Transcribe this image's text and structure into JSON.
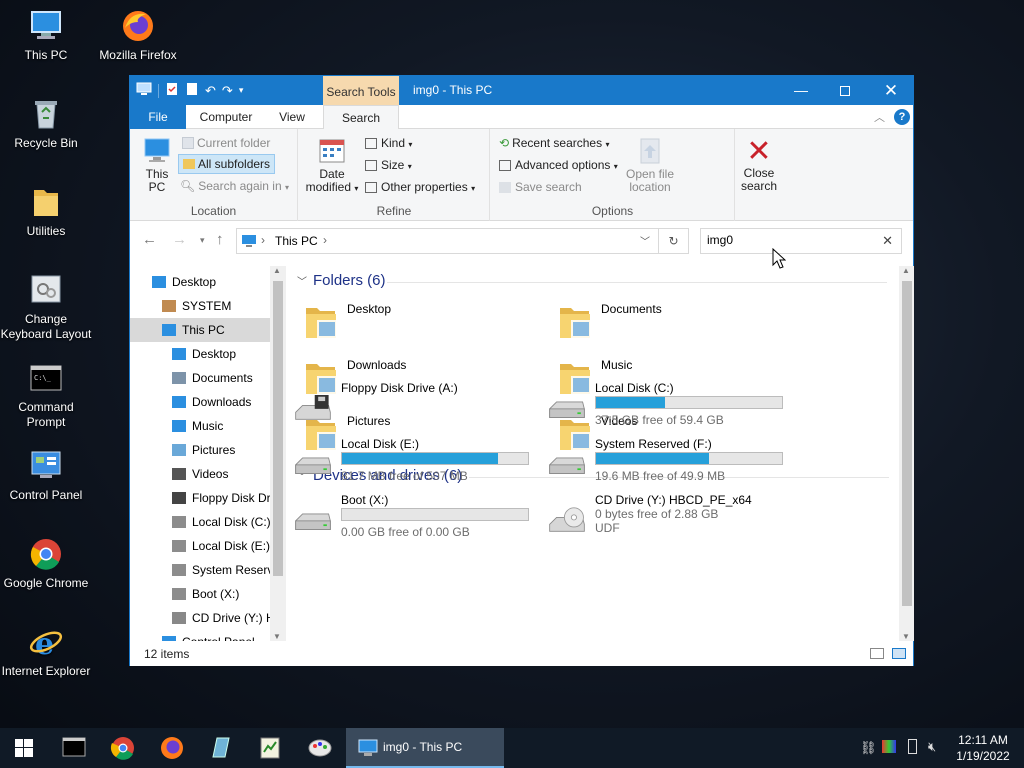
{
  "desktop": {
    "icons": [
      {
        "label": "This PC"
      },
      {
        "label": "Mozilla Firefox"
      },
      {
        "label": "Recycle Bin"
      },
      {
        "label": "Utilities"
      },
      {
        "label": "Change Keyboard Layout"
      },
      {
        "label": "Command Prompt"
      },
      {
        "label": "Control Panel"
      },
      {
        "label": "Google Chrome"
      },
      {
        "label": "Internet Explorer"
      }
    ]
  },
  "window": {
    "title": "img0 - This PC",
    "context_tab": "Search Tools",
    "tabs": {
      "file": "File",
      "computer": "Computer",
      "view": "View",
      "search": "Search"
    },
    "ribbon": {
      "location": {
        "label": "Location",
        "this_pc": "This PC",
        "current_folder": "Current folder",
        "all_subfolders": "All subfolders",
        "search_again": "Search again in"
      },
      "refine": {
        "label": "Refine",
        "date_modified": "Date modified",
        "kind": "Kind",
        "size": "Size",
        "other_properties": "Other properties"
      },
      "options": {
        "label": "Options",
        "recent_searches": "Recent searches",
        "advanced_options": "Advanced options",
        "save_search": "Save search",
        "open_file_location": "Open file location"
      },
      "close_search": "Close search"
    },
    "address": {
      "path": "This PC",
      "search_value": "img0"
    },
    "nav_pane": [
      {
        "label": "Desktop",
        "level": 0,
        "icon": "desktop"
      },
      {
        "label": "SYSTEM",
        "level": 1,
        "icon": "user"
      },
      {
        "label": "This PC",
        "level": 1,
        "icon": "pc",
        "selected": true
      },
      {
        "label": "Desktop",
        "level": 2,
        "icon": "desktop"
      },
      {
        "label": "Documents",
        "level": 2,
        "icon": "documents"
      },
      {
        "label": "Downloads",
        "level": 2,
        "icon": "downloads"
      },
      {
        "label": "Music",
        "level": 2,
        "icon": "music"
      },
      {
        "label": "Pictures",
        "level": 2,
        "icon": "pictures"
      },
      {
        "label": "Videos",
        "level": 2,
        "icon": "videos"
      },
      {
        "label": "Floppy Disk Dri",
        "level": 2,
        "icon": "floppy"
      },
      {
        "label": "Local Disk (C:)",
        "level": 2,
        "icon": "disk"
      },
      {
        "label": "Local Disk (E:)",
        "level": 2,
        "icon": "disk"
      },
      {
        "label": "System Reserve",
        "level": 2,
        "icon": "disk"
      },
      {
        "label": "Boot (X:)",
        "level": 2,
        "icon": "disk"
      },
      {
        "label": "CD Drive (Y:) H",
        "level": 2,
        "icon": "cd"
      },
      {
        "label": "Control Panel",
        "level": 1,
        "icon": "control"
      }
    ],
    "folders_header": "Folders (6)",
    "folders": [
      {
        "label": "Desktop",
        "icon": "desktop-folder-icon"
      },
      {
        "label": "Documents",
        "icon": "documents-folder-icon"
      },
      {
        "label": "Downloads",
        "icon": "downloads-folder-icon"
      },
      {
        "label": "Music",
        "icon": "music-folder-icon"
      },
      {
        "label": "Pictures",
        "icon": "pictures-folder-icon"
      },
      {
        "label": "Videos",
        "icon": "videos-folder-icon"
      }
    ],
    "drives_header": "Devices and drives (6)",
    "drives": [
      {
        "label": "Floppy Disk Drive (A:)",
        "type": "floppy"
      },
      {
        "label": "Local Disk (C:)",
        "free": "37.5 GB free of 59.4 GB",
        "used_fraction": 0.37,
        "type": "hdd"
      },
      {
        "label": "Local Disk (E:)",
        "free": "81.7 MB free of 507 MB",
        "used_fraction": 0.84,
        "type": "hdd"
      },
      {
        "label": "System Reserved (F:)",
        "free": "19.6 MB free of 49.9 MB",
        "used_fraction": 0.61,
        "type": "hdd"
      },
      {
        "label": "Boot (X:)",
        "free": "0.00 GB free of 0.00 GB",
        "used_fraction": 0,
        "type": "hdd"
      },
      {
        "label": "CD Drive (Y:) HBCD_PE_x64",
        "free": "0 bytes free of 2.88 GB",
        "extra": "UDF",
        "type": "cd"
      }
    ],
    "status": "12 items"
  },
  "taskbar": {
    "active_window": "img0 - This PC",
    "time": "12:11 AM",
    "date": "1/19/2022"
  },
  "colors": {
    "accent": "#1979ca",
    "context_tab": "#f6d9ae",
    "drive_fill": "#26a0da",
    "section_header": "#1e3287"
  }
}
